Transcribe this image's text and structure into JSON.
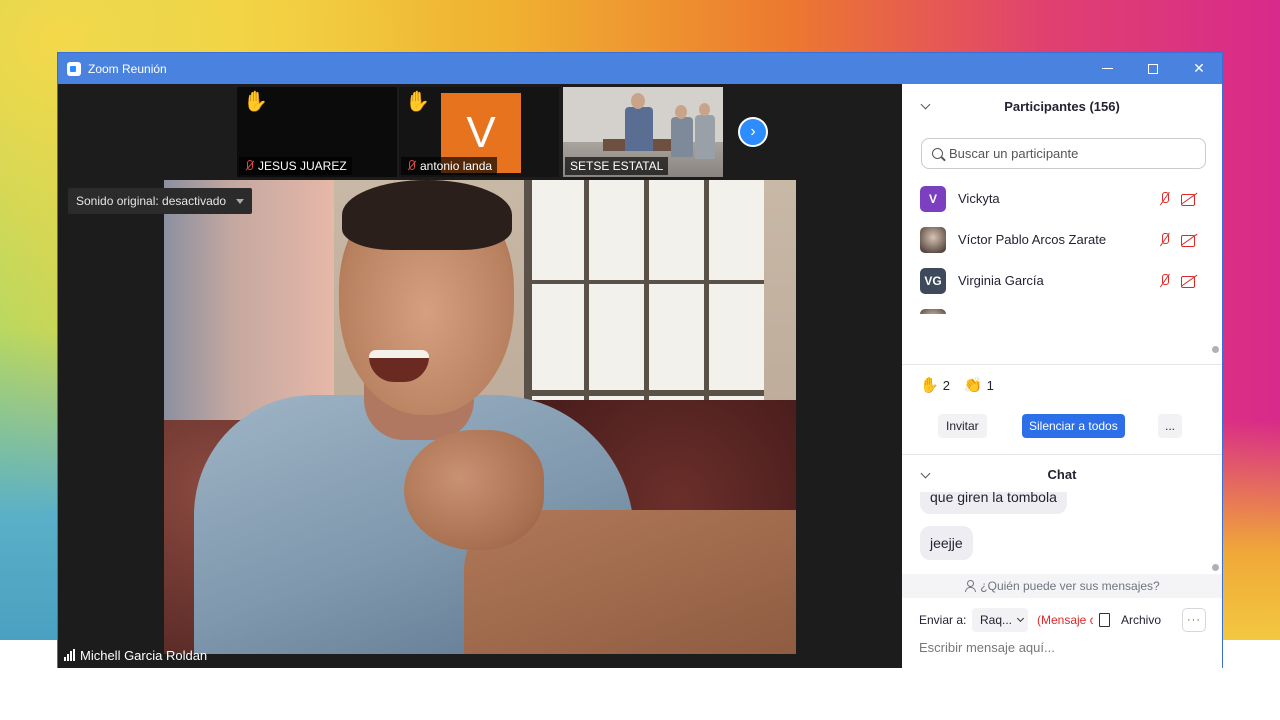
{
  "window": {
    "title": "Zoom Reunión"
  },
  "thumbnails": [
    {
      "name": "JESUS JUAREZ",
      "hand_raised": true,
      "muted": true,
      "type": "black"
    },
    {
      "name": "antonio landa",
      "hand_raised": true,
      "muted": true,
      "type": "avatar",
      "avatar_letter": "V",
      "avatar_color": "#e8731f"
    },
    {
      "name": "SETSE ESTATAL",
      "hand_raised": false,
      "muted": false,
      "type": "video"
    }
  ],
  "icons": {
    "raised_hand": "✋",
    "clap": "👏",
    "next": "›"
  },
  "main_video": {
    "original_sound": "Sonido original: desactivado",
    "speaker_name": "Michell Garcia Roldan"
  },
  "participants_panel": {
    "title": "Participantes (156)",
    "search_placeholder": "Buscar un participante",
    "participants": [
      {
        "initials": "V",
        "name": "Vickyta",
        "avatar_color": "#7b3fbf",
        "photo": false
      },
      {
        "initials": "",
        "name": "Víctor Pablo Arcos Zarate",
        "avatar_color": "#6a5a50",
        "photo": true
      },
      {
        "initials": "VG",
        "name": "Virginia García",
        "avatar_color": "#3e4a5c",
        "photo": false
      }
    ],
    "reactions": [
      {
        "icon": "raised-hand-icon",
        "count": "2"
      },
      {
        "icon": "clap-icon",
        "count": "1"
      }
    ],
    "invite_label": "Invitar",
    "mute_all_label": "Silenciar a todos",
    "more_label": "..."
  },
  "chat": {
    "title": "Chat",
    "messages": [
      "que giren la tombola",
      "jeejje"
    ],
    "privacy_text": "¿Quién puede ver sus mensajes?",
    "send_to_label": "Enviar a:",
    "recipient": "Raq...",
    "private_label": "(Mensaje c",
    "file_label": "Archivo",
    "more_label": "···",
    "input_placeholder": "Escribir mensaje aquí..."
  },
  "colors": {
    "titlebar": "#4a82e0",
    "accent": "#2d6fe8",
    "muted_red": "#e02828"
  }
}
